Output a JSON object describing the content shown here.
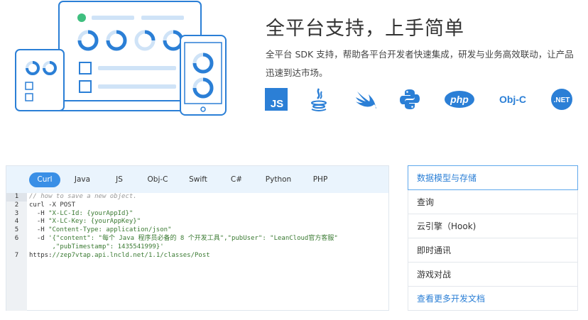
{
  "hero": {
    "title": "全平台支持，上手简单",
    "description": "全平台 SDK 支持，帮助各平台开发者快速集成，研发与业务高效联动，让产品迅速到达市场。"
  },
  "platforms": [
    {
      "name": "js-icon",
      "label": "JS",
      "color": "#2b7fd6"
    },
    {
      "name": "java-icon",
      "label": "",
      "color": "#2b7fd6"
    },
    {
      "name": "swift-icon",
      "label": "",
      "color": "#2b7fd6"
    },
    {
      "name": "python-icon",
      "label": "",
      "color": "#2b7fd6"
    },
    {
      "name": "php-icon",
      "label": "php",
      "color": "#2b7fd6"
    },
    {
      "name": "objc-icon",
      "label": "Obj-C",
      "color": "#2b7fd6"
    },
    {
      "name": "dotnet-icon",
      "label": ".NET",
      "color": "#2b7fd6"
    }
  ],
  "tabs": [
    {
      "label": "Curl",
      "active": true
    },
    {
      "label": "Java",
      "active": false
    },
    {
      "label": "JS",
      "active": false
    },
    {
      "label": "Obj-C",
      "active": false
    },
    {
      "label": "Swift",
      "active": false
    },
    {
      "label": "C#",
      "active": false
    },
    {
      "label": "Python",
      "active": false
    },
    {
      "label": "PHP",
      "active": false
    }
  ],
  "code": {
    "line_numbers": [
      "1",
      "2",
      "3",
      "4",
      "5",
      "6",
      "",
      "7"
    ],
    "lines": [
      {
        "cls": "cm",
        "parts": [
          {
            "t": "// how to save a new object.",
            "c": "cm"
          }
        ]
      },
      {
        "parts": [
          {
            "t": "curl -X POST",
            "c": ""
          }
        ]
      },
      {
        "parts": [
          {
            "t": "  -H ",
            "c": ""
          },
          {
            "t": "\"X-LC-Id: {yourAppId}\"",
            "c": "str"
          }
        ]
      },
      {
        "parts": [
          {
            "t": "  -H ",
            "c": ""
          },
          {
            "t": "\"X-LC-Key: {yourAppKey}\"",
            "c": "str"
          }
        ]
      },
      {
        "parts": [
          {
            "t": "  -H ",
            "c": ""
          },
          {
            "t": "\"Content-Type: application/json\"",
            "c": "str"
          }
        ]
      },
      {
        "parts": [
          {
            "t": "  -d ",
            "c": ""
          },
          {
            "t": "'{\"content\": \"每个 Java 程序员必备的 8 个开发工具\",\"pubUser\": \"LeanCloud官方客服\"",
            "c": "str"
          }
        ]
      },
      {
        "parts": [
          {
            "t": "      ,\"pubTimestamp\": 1435541999}'",
            "c": "str"
          }
        ]
      },
      {
        "parts": [
          {
            "t": "https:",
            "c": ""
          },
          {
            "t": "//zep7vtap.api.lncld.net/1.1/classes/Post",
            "c": "url"
          }
        ]
      }
    ]
  },
  "side_menu": [
    {
      "label": "数据模型与存储",
      "active": true,
      "link": false
    },
    {
      "label": "查询",
      "active": false,
      "link": false
    },
    {
      "label": "云引擎（Hook)",
      "active": false,
      "link": false
    },
    {
      "label": "即时通讯",
      "active": false,
      "link": false
    },
    {
      "label": "游戏对战",
      "active": false,
      "link": false
    },
    {
      "label": "查看更多开发文档",
      "active": false,
      "link": true
    }
  ]
}
